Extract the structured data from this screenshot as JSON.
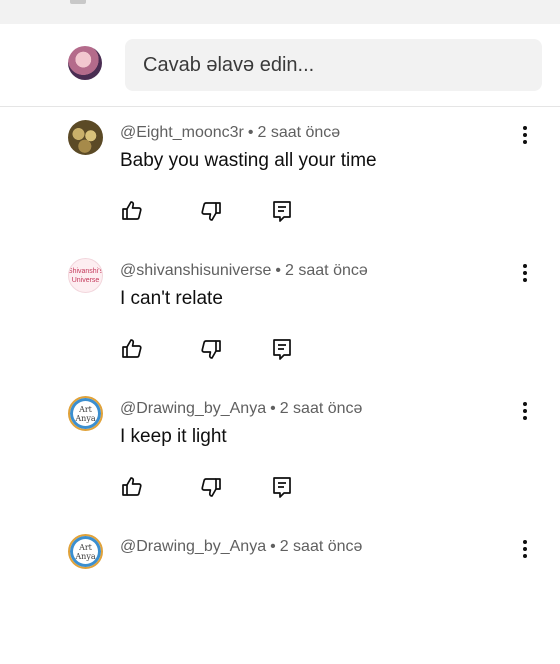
{
  "reply_bar": {
    "placeholder": "Cavab əlavə edin..."
  },
  "comments": [
    {
      "author": "@Eight_moonc3r",
      "separator": "•",
      "time": "2 saat öncə",
      "text": "Baby you wasting all your time"
    },
    {
      "author": "@shivanshisuniverse",
      "separator": "•",
      "time": "2 saat öncə",
      "text": "I can't relate",
      "avatar_text": [
        "Shivanshi's",
        "Universe"
      ]
    },
    {
      "author": "@Drawing_by_Anya",
      "separator": "•",
      "time": "2 saat öncə",
      "text": "I keep it light",
      "avatar_text": [
        "Art",
        "Anya"
      ]
    },
    {
      "author": "@Drawing_by_Anya",
      "separator": "•",
      "time": "2 saat öncə",
      "text": "",
      "avatar_text": [
        "Art",
        "Anya"
      ]
    }
  ],
  "icons": {
    "like": "thumb-up-icon",
    "dislike": "thumb-down-icon",
    "reply": "comment-icon",
    "menu": "more-vert-icon"
  }
}
